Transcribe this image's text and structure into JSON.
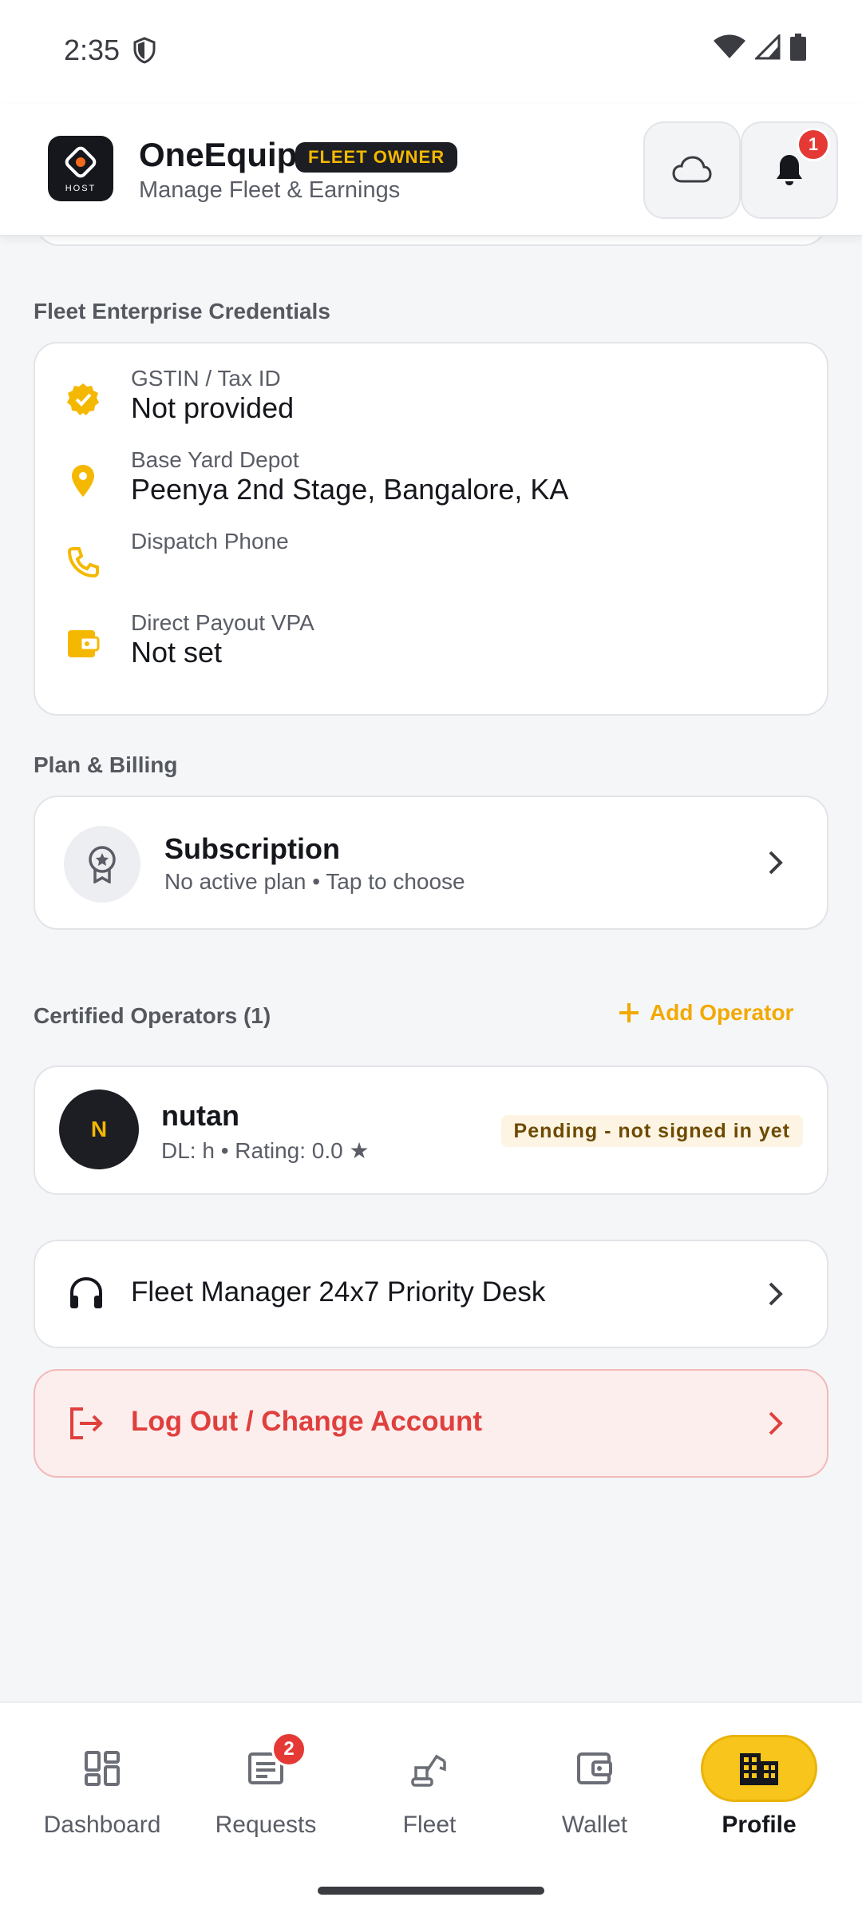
{
  "status_bar": {
    "time": "2:35"
  },
  "header": {
    "logo_text": "HOST",
    "title": "OneEquip",
    "badge": "FLEET OWNER",
    "subtitle": "Manage Fleet & Earnings",
    "notification_count": "1"
  },
  "credentials": {
    "section_title": "Fleet Enterprise Credentials",
    "items": [
      {
        "icon": "verified-badge-icon",
        "label": "GSTIN / Tax ID",
        "value": "Not provided"
      },
      {
        "icon": "location-pin-icon",
        "label": "Base Yard Depot",
        "value": "Peenya 2nd Stage, Bangalore, KA"
      },
      {
        "icon": "phone-icon",
        "label": "Dispatch Phone",
        "value": ""
      },
      {
        "icon": "wallet-icon",
        "label": "Direct Payout VPA",
        "value": "Not set"
      }
    ]
  },
  "billing": {
    "section_title": "Plan & Billing",
    "subscription_title": "Subscription",
    "subscription_desc": "No active plan • Tap to choose"
  },
  "operators": {
    "section_title": "Certified Operators (1)",
    "add_label": "Add Operator",
    "items": [
      {
        "initial": "N",
        "name": "nutan",
        "meta": "DL: h • Rating: 0.0 ★",
        "status": "Pending - not signed in yet"
      }
    ]
  },
  "support": {
    "label": "Fleet Manager 24x7 Priority Desk"
  },
  "logout": {
    "label": "Log Out / Change Account"
  },
  "nav": {
    "items": [
      {
        "label": "Dashboard",
        "icon": "dashboard-icon"
      },
      {
        "label": "Requests",
        "icon": "requests-icon",
        "badge": "2"
      },
      {
        "label": "Fleet",
        "icon": "excavator-icon"
      },
      {
        "label": "Wallet",
        "icon": "wallet-icon"
      },
      {
        "label": "Profile",
        "icon": "building-icon"
      }
    ],
    "active": "Profile"
  },
  "colors": {
    "accent": "#f5b800",
    "danger": "#e0403d",
    "dark": "#1c1e24"
  }
}
